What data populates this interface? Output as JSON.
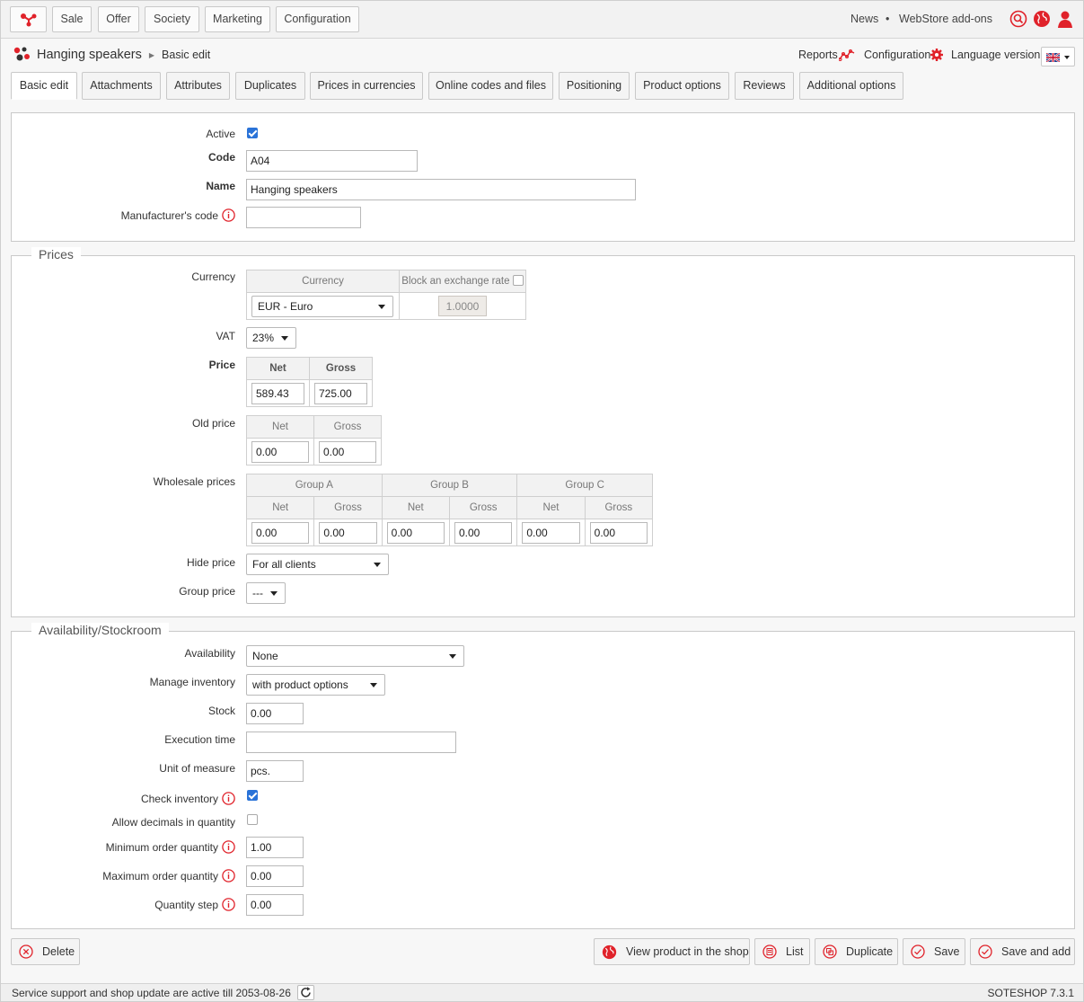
{
  "topnav": {
    "items": [
      "Sale",
      "Offer",
      "Society",
      "Marketing",
      "Configuration"
    ],
    "news": "News",
    "bullet": "•",
    "addons": "WebStore add-ons"
  },
  "breadcrumb": {
    "title": "Hanging speakers",
    "sub": "Basic edit"
  },
  "header_links": {
    "reports": "Reports",
    "configuration": "Configuration",
    "language": "Language version"
  },
  "tabs": [
    "Basic edit",
    "Attachments",
    "Attributes",
    "Duplicates",
    "Prices in currencies",
    "Online codes and files",
    "Positioning",
    "Product options",
    "Reviews",
    "Additional options"
  ],
  "general": {
    "active_label": "Active",
    "active": true,
    "code_label": "Code",
    "code": "A04",
    "name_label": "Name",
    "name": "Hanging speakers",
    "mcode_label": "Manufacturer's code",
    "mcode": ""
  },
  "prices": {
    "legend": "Prices",
    "currency_label": "Currency",
    "currency_col": "Currency",
    "block_col": "Block an exchange rate",
    "currency_value": "EUR - Euro",
    "rate": "1.0000",
    "vat_label": "VAT",
    "vat": "23%",
    "price_label": "Price",
    "net": "Net",
    "gross": "Gross",
    "price_net": "589.43",
    "price_gross": "725.00",
    "old_label": "Old price",
    "old_net": "0.00",
    "old_gross": "0.00",
    "wholesale_label": "Wholesale prices",
    "groups": [
      {
        "name": "Group A",
        "net": "0.00",
        "gross": "0.00"
      },
      {
        "name": "Group B",
        "net": "0.00",
        "gross": "0.00"
      },
      {
        "name": "Group C",
        "net": "0.00",
        "gross": "0.00"
      }
    ],
    "hide_label": "Hide price",
    "hide": "For all clients",
    "group_price_label": "Group price",
    "group_price": "---"
  },
  "stock": {
    "legend": "Availability/Stockroom",
    "availability_label": "Availability",
    "availability": "None",
    "manage_label": "Manage inventory",
    "manage": "with product options",
    "stock_label": "Stock",
    "stock": "0.00",
    "exec_label": "Execution time",
    "exec": "",
    "unit_label": "Unit of measure",
    "unit": "pcs.",
    "check_label": "Check inventory",
    "check": true,
    "decimals_label": "Allow decimals in quantity",
    "decimals": false,
    "min_label": "Minimum order quantity",
    "min": "1.00",
    "max_label": "Maximum order quantity",
    "max": "0.00",
    "step_label": "Quantity step",
    "step": "0.00"
  },
  "buttons": {
    "delete": "Delete",
    "view": "View product in the shop",
    "list": "List",
    "duplicate": "Duplicate",
    "save": "Save",
    "save_add": "Save and add"
  },
  "footer": {
    "support": "Service support and shop update are active till 2053-08-26",
    "version": "SOTESHOP 7.3.1"
  },
  "colors": {
    "accent": "#e0222a",
    "check": "#2a73d8"
  }
}
